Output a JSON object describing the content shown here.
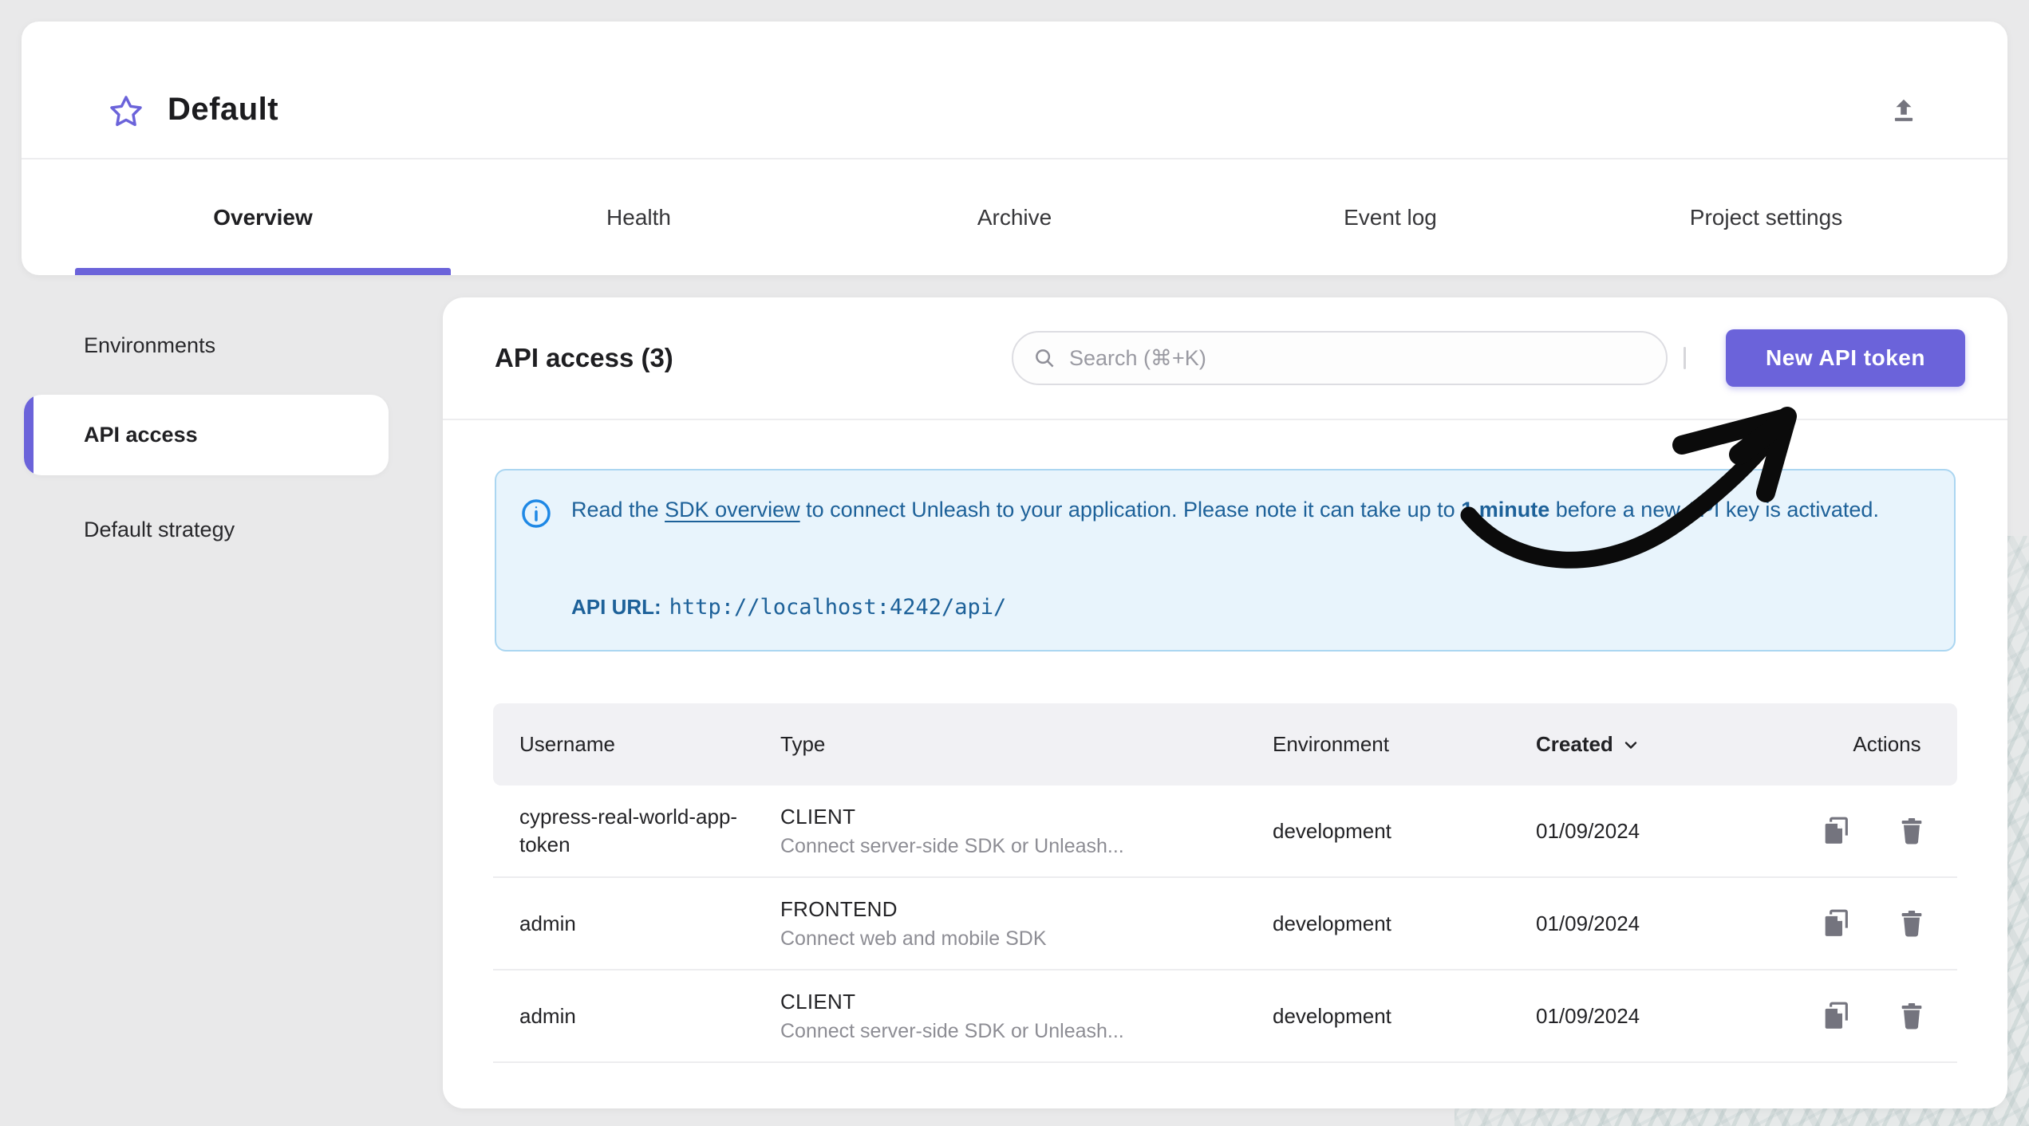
{
  "colors": {
    "accent": "#6b63da",
    "info_blue": "#1e88e5",
    "alert_text": "#1d6199",
    "alert_bg": "#e8f4fc",
    "alert_border": "#abd6f1",
    "icon_gray": "#74747e"
  },
  "project_header": {
    "title": "Default"
  },
  "tabs": [
    {
      "label": "Overview",
      "active": true
    },
    {
      "label": "Health",
      "active": false
    },
    {
      "label": "Archive",
      "active": false
    },
    {
      "label": "Event log",
      "active": false
    },
    {
      "label": "Project settings",
      "active": false
    }
  ],
  "sidebar": {
    "items": [
      {
        "label": "Environments",
        "active": false
      },
      {
        "label": "API access",
        "active": true
      },
      {
        "label": "Default strategy",
        "active": false
      }
    ]
  },
  "main": {
    "title": "API access (3)",
    "search": {
      "placeholder": "Search (⌘+K)"
    },
    "new_token_button": "New API token",
    "alert": {
      "segments": [
        {
          "text": "Read the ",
          "style": "normal"
        },
        {
          "text": "SDK overview",
          "style": "link"
        },
        {
          "text": " to connect Unleash to your application. Please note it can take up to ",
          "style": "normal"
        },
        {
          "text": "1 minute",
          "style": "bold"
        },
        {
          "text": " before a new API key is activated.",
          "style": "normal"
        }
      ],
      "api_url_label": "API URL:",
      "api_url": "http://localhost:4242/api/"
    },
    "table": {
      "columns": {
        "username": "Username",
        "type": "Type",
        "environment": "Environment",
        "created": "Created",
        "actions": "Actions"
      },
      "sorted_by": "Created",
      "rows": [
        {
          "username": "cypress-real-world-app-token",
          "type": "CLIENT",
          "type_description": "Connect server-side SDK or Unleash...",
          "environment": "development",
          "created": "01/09/2024"
        },
        {
          "username": "admin",
          "type": "FRONTEND",
          "type_description": "Connect web and mobile SDK",
          "environment": "development",
          "created": "01/09/2024"
        },
        {
          "username": "admin",
          "type": "CLIENT",
          "type_description": "Connect server-side SDK or Unleash...",
          "environment": "development",
          "created": "01/09/2024"
        }
      ]
    }
  }
}
